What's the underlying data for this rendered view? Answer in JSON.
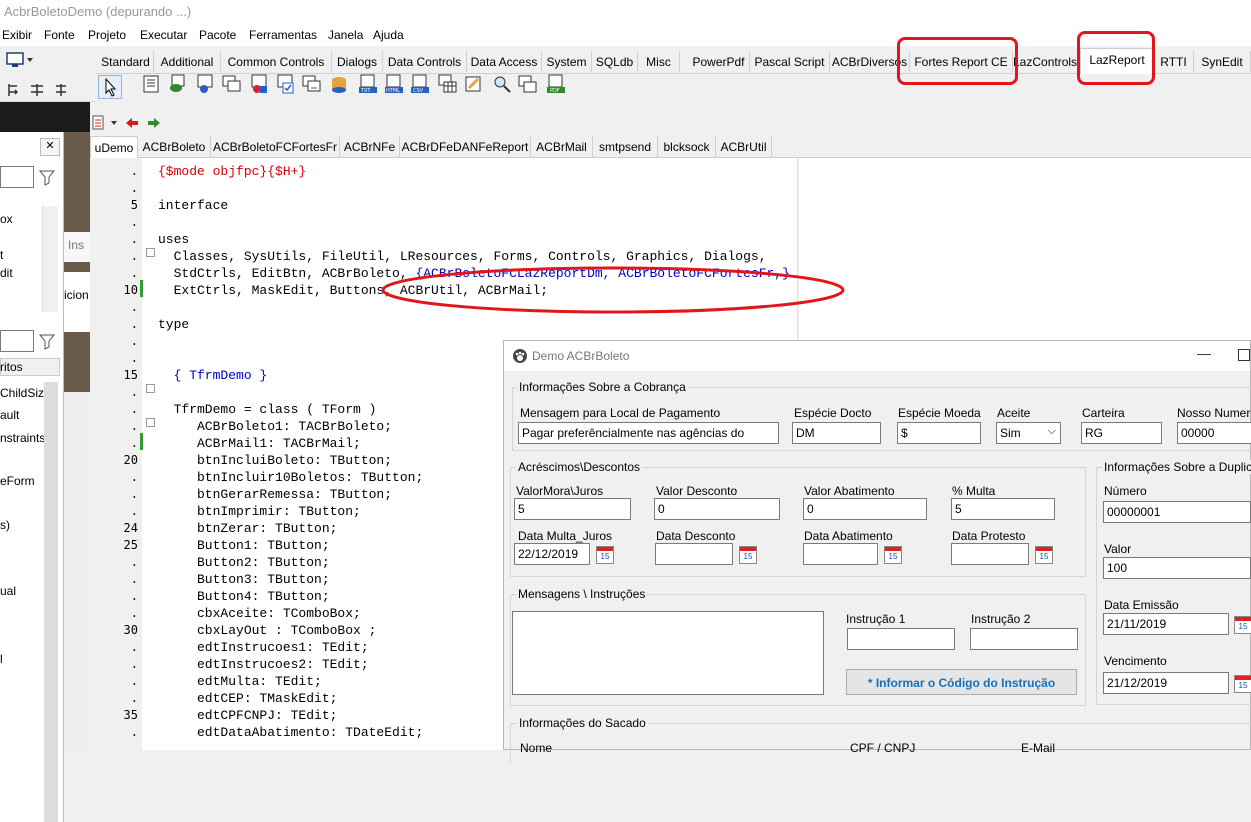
{
  "window_title": "AcbrBoletoDemo (depurando ...)",
  "menu": [
    "Exibir",
    "Fonte",
    "Projeto",
    "Executar",
    "Pacote",
    "Ferramentas",
    "Janela",
    "Ajuda"
  ],
  "palette_tabs": [
    "Standard",
    "Additional",
    "Common Controls",
    "Dialogs",
    "Data Controls",
    "Data Access",
    "System",
    "SQLdb",
    "Misc",
    "PowerPdf",
    "Pascal Script",
    "ACBrDiversos",
    "Fortes Report CE",
    "LazControls",
    "LazReport",
    "RTTI",
    "SynEdit"
  ],
  "left_panel": {
    "items": [
      "ox",
      "t",
      "dit",
      "Ins",
      "icion",
      "ritos",
      "ChildSiz",
      "ault",
      "nstraints",
      "eForm",
      "s)",
      "ual",
      "l"
    ]
  },
  "file_tabs": [
    "uDemo",
    "ACBrBoleto",
    "ACBrBoletoFCFortesFr",
    "ACBrNFe",
    "ACBrDFeDANFeReport",
    "ACBrMail",
    "smtpsend",
    "blcksock",
    "ACBrUtil"
  ],
  "code": {
    "line_numbers": [
      "",
      "",
      "5",
      "",
      "",
      "",
      "",
      "10",
      "",
      "",
      "",
      "",
      "15",
      "",
      "",
      "",
      "",
      "20",
      "",
      "",
      "",
      "24",
      "25",
      "",
      "",
      "",
      "",
      "30",
      "",
      "",
      "",
      "",
      "35",
      ""
    ],
    "lines": [
      "{$mode objfpc}{$H+}",
      "",
      "interface",
      "",
      "uses",
      "  Classes, SysUtils, FileUtil, LResources, Forms, Controls, Graphics, Dialogs,",
      "  StdCtrls, EditBtn, ACBrBoleto, {ACBrBoletoFCLazReportDm, ACBrBoletoFCFortesFr,}",
      "  ExtCtrls, MaskEdit, Buttons, ACBrUtil, ACBrMail;",
      "",
      "type",
      "",
      "",
      "  { TfrmDemo }",
      "",
      "  TfrmDemo = class ( TForm )",
      "     ACBrBoleto1: TACBrBoleto;",
      "     ACBrMail1: TACBrMail;",
      "     btnIncluiBoleto: TButton;",
      "     btnIncluir10Boletos: TButton;",
      "     btnGerarRemessa: TButton;",
      "     btnImprimir: TButton;",
      "     btnZerar: TButton;",
      "     Button1: TButton;",
      "     Button2: TButton;",
      "     Button3: TButton;",
      "     Button4: TButton;",
      "     cbxAceite: TComboBox;",
      "     cbxLayOut : TComboBox ;",
      "     edtInstrucoes1: TEdit;",
      "     edtInstrucoes2: TEdit;",
      "     edtMulta: TEdit;",
      "     edtCEP: TMaskEdit;",
      "     edtCPFCNPJ: TEdit;",
      "     edtDataAbatimento: TDateEdit;"
    ]
  },
  "demo": {
    "title": "Demo ACBrBoleto",
    "g1_title": "Informações Sobre a Cobrança",
    "mensagem_label": "Mensagem  para Local  de Pagamento",
    "mensagem_value": "Pagar preferêncialmente nas agências do",
    "especie_docto_label": "Espécie Docto",
    "especie_docto_value": "DM",
    "especie_moeda_label": "Espécie Moeda",
    "especie_moeda_value": "$",
    "aceite_label": "Aceite",
    "aceite_value": "Sim",
    "carteira_label": "Carteira",
    "carteira_value": "RG",
    "nosso_label": "Nosso Numero",
    "nosso_value": "00000",
    "g2_title": "Acréscimos\\Descontos",
    "mora_label": "ValorMora\\Juros",
    "mora_value": "5",
    "desconto_label": "Valor Desconto",
    "desconto_value": "0",
    "abatimento_label": "Valor Abatimento",
    "abatimento_value": "0",
    "multa_label": "% Multa",
    "multa_value": "5",
    "data_multa_label": "Data Multa_Juros",
    "data_multa_value": "22/12/2019",
    "data_desconto_label": "Data Desconto",
    "data_abatimento_label": "Data Abatimento",
    "data_protesto_label": "Data Protesto",
    "cal_label": "15",
    "g3_title": "Informações Sobre a Duplicata",
    "numero_label": "Número",
    "numero_value": "00000001",
    "valor_label": "Valor",
    "valor_value": "100",
    "data_emissao_label": "Data Emissão",
    "data_emissao_value": "21/11/2019",
    "vencimento_label": "Vencimento",
    "vencimento_value": "21/12/2019",
    "g4_title": "Mensagens \\ Instruções",
    "instrucao1_label": "Instrução 1",
    "instrucao2_label": "Instrução 2",
    "informar_button": "* Informar o Código do Instrução",
    "g5_title": "Informações do Sacado",
    "nome_label": "Nome",
    "cpf_label": "CPF / CNPJ",
    "email_label": "E-Mail"
  }
}
